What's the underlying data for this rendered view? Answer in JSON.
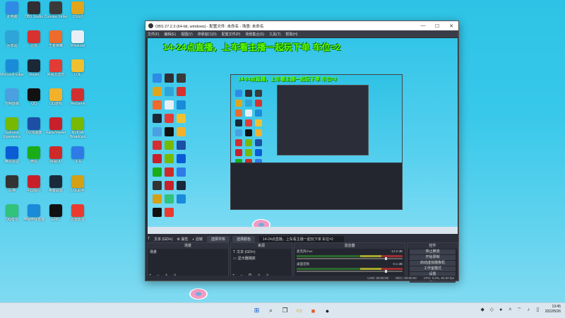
{
  "desktop_icons": [
    {
      "label": "此电脑",
      "color": "#2f8be6"
    },
    {
      "label": "OBS Studio",
      "color": "#302f34"
    },
    {
      "label": "Counter-Strike",
      "color": "#3a3a3a"
    },
    {
      "label": "CSGO",
      "color": "#e1a51c"
    },
    {
      "label": "回收站",
      "color": "#2ea4d8"
    },
    {
      "label": "迅雷",
      "color": "#d8322f"
    },
    {
      "label": "王者荣耀",
      "color": "#ef6b2c"
    },
    {
      "label": "Windows",
      "color": "#e8eef5"
    },
    {
      "label": "Microsoft Edge",
      "color": "#1a8bd9"
    },
    {
      "label": "Steam",
      "color": "#1b2838"
    },
    {
      "label": "网易云音乐",
      "color": "#e33b35"
    },
    {
      "label": "LOL",
      "color": "#f0c030"
    },
    {
      "label": "控制面板",
      "color": "#4aa0e0"
    },
    {
      "label": "QQ",
      "color": "#111"
    },
    {
      "label": "QQ游戏",
      "color": "#f3b12b"
    },
    {
      "label": "WeGame",
      "color": "#d23030"
    },
    {
      "label": "GeForce Experience",
      "color": "#76b900"
    },
    {
      "label": "UU加速器",
      "color": "#1d4fa5"
    },
    {
      "label": "GameViewer",
      "color": "#c8202a"
    },
    {
      "label": "NVIDIA Broadcast",
      "color": "#76b900"
    },
    {
      "label": "腾讯会议",
      "color": "#0a5bd6"
    },
    {
      "label": "微信",
      "color": "#1aad19"
    },
    {
      "label": "网易UU",
      "color": "#cf2a2a"
    },
    {
      "label": "飞书",
      "color": "#2e7be8"
    },
    {
      "label": "原神",
      "color": "#333"
    },
    {
      "label": "中国银行",
      "color": "#c8202a"
    },
    {
      "label": "英雄联盟",
      "color": "#1a2a3a"
    },
    {
      "label": "LOL助手",
      "color": "#d4a017"
    },
    {
      "label": "QQ音乐",
      "color": "#31c27c"
    },
    {
      "label": "哔哩哔哩直播",
      "color": "#1a8bd9"
    },
    {
      "label": "EPIC",
      "color": "#111"
    },
    {
      "label": "迅雷影音",
      "color": "#ea3a30"
    }
  ],
  "obs": {
    "title": "OBS 27.2.3 (64-bit, windows) - 配置文件: 未命名 - 场景: 未命名",
    "menu": [
      "文件(F)",
      "编辑(E)",
      "视图(V)",
      "停靠窗口(D)",
      "配置文件(P)",
      "场景集合(S)",
      "工具(T)",
      "帮助(H)"
    ],
    "preview_title": "14-24点直播，上车看主播一起玩下单 车位=2",
    "toolstrip": {
      "source_label": "文本 (GDI+)",
      "properties": "属性",
      "filters": "滤镜",
      "select_font": "选择字体",
      "select_color": "选择颜色",
      "text_value": "14-24点直播，上车看主播一起玩下单 车位=2"
    },
    "docks": {
      "scenes": {
        "title": "场景",
        "items": [
          "场景"
        ]
      },
      "sources": {
        "title": "来源",
        "items": [
          "文本 (GDI+)",
          "显示器捕获"
        ]
      },
      "mixer": {
        "title": "混音器",
        "tracks": [
          {
            "name": "麦克风/Aux",
            "db": "-12.0 dB"
          },
          {
            "name": "桌面音频",
            "db": "-0.1 dB"
          }
        ]
      },
      "controls": {
        "title": "控件",
        "buttons": [
          "停止推流",
          "开始录制",
          "启动虚拟摄像机",
          "工作室模式",
          "设置",
          "退出"
        ]
      }
    },
    "status": {
      "live": "LIVE: 00:00:00",
      "rec": "REC: 00:00:00",
      "cpu": "CPU: 0.0%, 60.00 fps"
    }
  },
  "taskbar": {
    "time": "13:45",
    "date": "2022/5/26"
  }
}
